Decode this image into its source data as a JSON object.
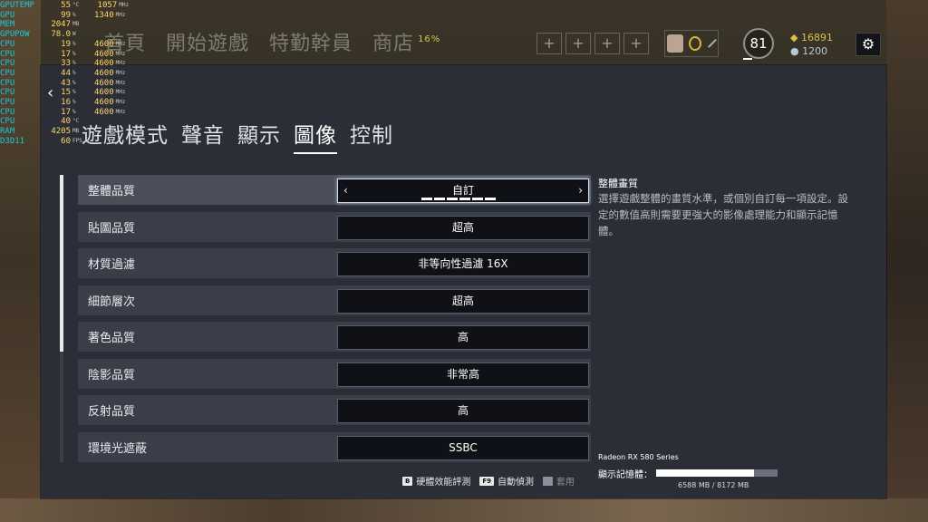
{
  "stats_overlay": [
    {
      "label": "GPUTEMP",
      "v1": "55",
      "u1": "°C",
      "v2": "1057",
      "u2": "MHz"
    },
    {
      "label": "GPU",
      "v1": "99",
      "u1": "%",
      "v2": "1340",
      "u2": "MHz"
    },
    {
      "label": "MEM",
      "v1": "2047",
      "u1": "MB",
      "v2": "",
      "u2": ""
    },
    {
      "label": "GPUPOW",
      "v1": "78.0",
      "u1": "W",
      "v2": "",
      "u2": ""
    },
    {
      "label": "CPU",
      "v1": "19",
      "u1": "%",
      "v2": "4600",
      "u2": "MHz"
    },
    {
      "label": "CPU",
      "v1": "17",
      "u1": "%",
      "v2": "4600",
      "u2": "MHz"
    },
    {
      "label": "CPU",
      "v1": "33",
      "u1": "%",
      "v2": "4600",
      "u2": "MHz"
    },
    {
      "label": "CPU",
      "v1": "44",
      "u1": "%",
      "v2": "4600",
      "u2": "MHz"
    },
    {
      "label": "CPU",
      "v1": "43",
      "u1": "%",
      "v2": "4600",
      "u2": "MHz"
    },
    {
      "label": "CPU",
      "v1": "15",
      "u1": "%",
      "v2": "4600",
      "u2": "MHz"
    },
    {
      "label": "CPU",
      "v1": "16",
      "u1": "%",
      "v2": "4600",
      "u2": "MHz"
    },
    {
      "label": "CPU",
      "v1": "17",
      "u1": "%",
      "v2": "4600",
      "u2": "MHz"
    },
    {
      "label": "CPU",
      "v1": "40",
      "u1": "°C",
      "v2": "",
      "u2": ""
    },
    {
      "label": "RAM",
      "v1": "4205",
      "u1": "MB",
      "v2": "",
      "u2": ""
    },
    {
      "label": "D3D11",
      "v1": "60",
      "u1": "FPS",
      "v2": "",
      "u2": ""
    }
  ],
  "topnav": {
    "items": [
      "首頁",
      "開始遊戲",
      "特勤幹員",
      "商店"
    ],
    "store_badge": "16%"
  },
  "loadout_slots": [
    "+",
    "+",
    "+",
    "+"
  ],
  "player": {
    "level": "81",
    "renown": "16891",
    "credits": "1200"
  },
  "back_label": "‹",
  "tabs": [
    "遊戲模式",
    "聲音",
    "顯示",
    "圖像",
    "控制"
  ],
  "active_tab": "圖像",
  "settings": [
    {
      "name": "整體品質",
      "value": "自訂"
    },
    {
      "name": "貼圖品質",
      "value": "超高"
    },
    {
      "name": "材質過濾",
      "value": "非等向性過濾 16X"
    },
    {
      "name": "細節層次",
      "value": "超高"
    },
    {
      "name": "著色品質",
      "value": "高"
    },
    {
      "name": "陰影品質",
      "value": "非常高"
    },
    {
      "name": "反射品質",
      "value": "高"
    },
    {
      "name": "環境光遮蔽",
      "value": "SSBC"
    }
  ],
  "quality_pips": {
    "count": 6,
    "active": 6
  },
  "description": {
    "title": "整體畫質",
    "body": "選擇遊戲整體的畫質水準，或個別自訂每一項設定。設定的數值高則需要更強大的影像處理能力和顯示記憶體。"
  },
  "gpu": {
    "name": "Radeon RX 580 Series",
    "vram_label": "顯示記憶體：",
    "vram_used": 6588,
    "vram_total": 8172,
    "vram_text": "6588 MB / 8172 MB"
  },
  "footer": {
    "benchmark_key": "B",
    "benchmark_label": "硬體效能評測",
    "autodetect_key": "F9",
    "autodetect_label": "自動偵測",
    "apply_label": "套用"
  }
}
